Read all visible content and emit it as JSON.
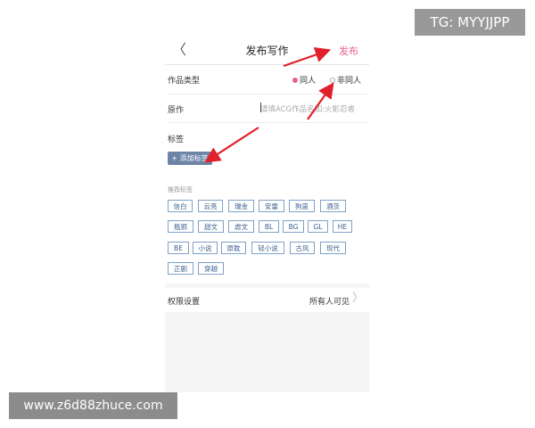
{
  "header": {
    "back_glyph": "〈",
    "title": "发布写作",
    "publish_label": "发布"
  },
  "form": {
    "type_label": "作品类型",
    "option_same": "同人",
    "option_not_same": "非同人",
    "selected_option": "同人",
    "original_label": "原作",
    "original_placeholder": "请填ACG作品名如:火影忍者",
    "tags_label": "标签",
    "add_tag_label": "+ 添加标签",
    "recommended_label": "推荐标签",
    "recommended_tags": [
      [
        "信白",
        "云亮",
        "瑞金",
        "安雷",
        "狗崽",
        "酒茨"
      ],
      [
        "瓶邪",
        "甜文",
        "虐文",
        "BL",
        "BG",
        "GL",
        "HE"
      ],
      [
        "BE",
        "小说",
        "原耽",
        "轻小说",
        "古风",
        "现代"
      ],
      [
        "正剧",
        "穿越"
      ]
    ]
  },
  "permissions": {
    "label": "权限设置",
    "value": "所有人可见",
    "chevron_glyph": "〉"
  },
  "watermarks": {
    "tg": "TG: MYYJJPP",
    "site": "www.z6d88zhuce.com"
  },
  "colors": {
    "accent": "#e8608a",
    "arrow": "#e0202a",
    "chip_border": "#7ea2c6",
    "add_tag_bg": "#6d84a6"
  }
}
